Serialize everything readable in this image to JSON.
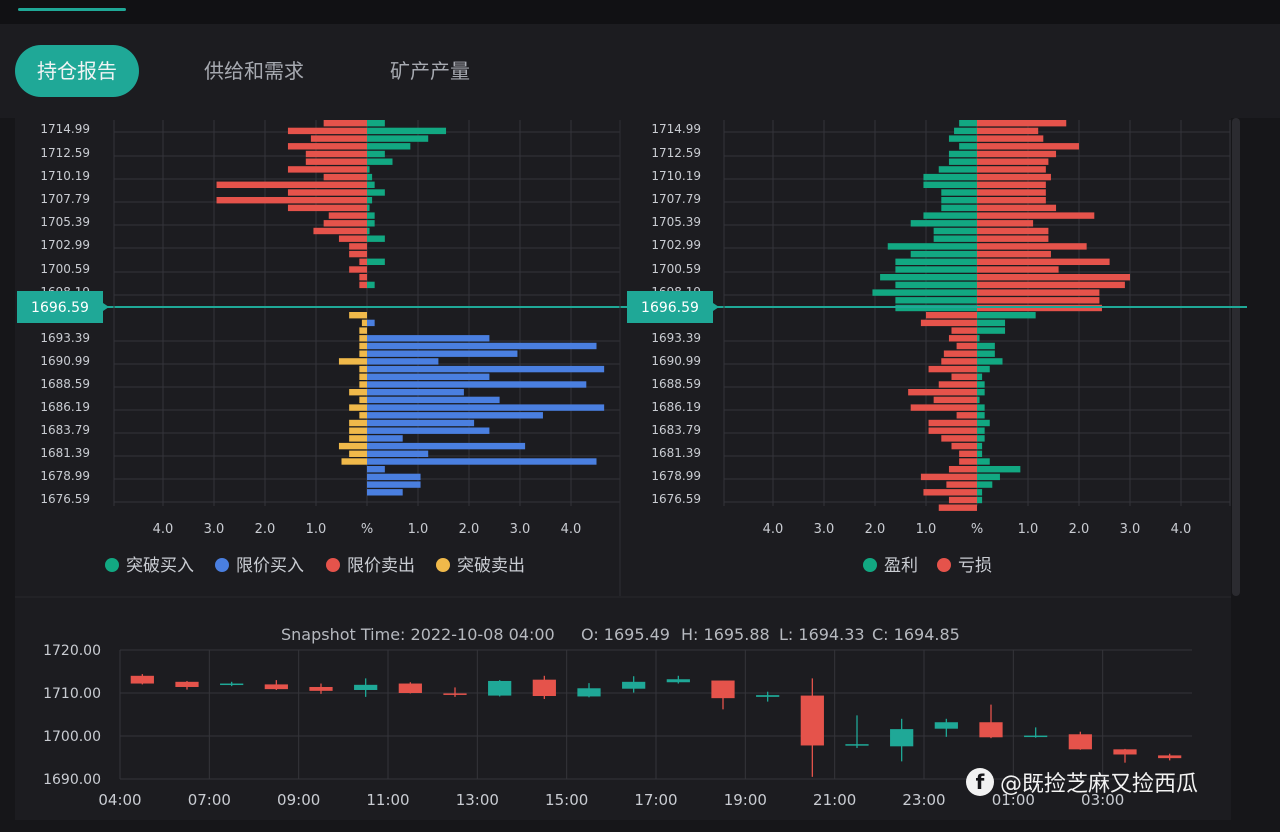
{
  "tabs": [
    {
      "label": "持仓报告",
      "active": true
    },
    {
      "label": "供给和需求",
      "active": false
    },
    {
      "label": "矿产产量",
      "active": false
    }
  ],
  "colors": {
    "green": "#12a882",
    "blue": "#4a7fe0",
    "red": "#e5534b",
    "yellow": "#f0b94a",
    "accent": "#1fa897",
    "grid": "#34343a",
    "text": "#c9ccd2"
  },
  "chart_data": [
    {
      "type": "bar",
      "orientation": "horizontal-butterfly",
      "y_tick_labels": [
        "1714.99",
        "1712.59",
        "1710.19",
        "1707.79",
        "1705.39",
        "1702.99",
        "1700.59",
        "1698.19",
        "1693.39",
        "1690.99",
        "1688.59",
        "1686.19",
        "1683.79",
        "1681.39",
        "1678.99",
        "1676.59"
      ],
      "current_price": "1696.59",
      "x_tick_labels": [
        "4.0",
        "3.0",
        "2.0",
        "1.0",
        "%",
        "1.0",
        "2.0",
        "3.0",
        "4.0"
      ],
      "xlim": [
        -4.8,
        4.8
      ],
      "legend": [
        "突破买入",
        "限价买入",
        "限价卖出",
        "突破卖出"
      ],
      "series": [
        {
          "name": "限价卖出",
          "side": "left",
          "rows_above": [
            0.85,
            1.55,
            1.1,
            1.55,
            1.2,
            1.2,
            1.55,
            0.85,
            2.95,
            1.55,
            2.95,
            1.55,
            0.75,
            0.85,
            1.05,
            0.55,
            0.35,
            0.35,
            0.15,
            0.35,
            0.15,
            0.15
          ]
        },
        {
          "name": "突破买入",
          "side": "right",
          "rows_above": [
            0.35,
            1.55,
            1.2,
            0.85,
            0.35,
            0.5,
            0.05,
            0.1,
            0.15,
            0.35,
            0.1,
            0.05,
            0.15,
            0.15,
            0.05,
            0.35,
            0.0,
            0.0,
            0.35,
            0.0,
            0.0,
            0.15
          ]
        },
        {
          "name": "突破卖出",
          "side": "left",
          "rows_below": [
            0.35,
            0.1,
            0.15,
            0.15,
            0.15,
            0.15,
            0.55,
            0.15,
            0.15,
            0.15,
            0.35,
            0.15,
            0.35,
            0.15,
            0.35,
            0.35,
            0.35,
            0.55,
            0.35,
            0.5
          ]
        },
        {
          "name": "限价买入",
          "side": "right",
          "rows_below": [
            0.0,
            0.15,
            0.0,
            2.4,
            4.5,
            2.95,
            1.4,
            4.65,
            2.4,
            4.3,
            1.9,
            2.6,
            4.65,
            3.45,
            2.1,
            2.4,
            0.7,
            3.1,
            1.2,
            4.5,
            0.35,
            1.05,
            1.05,
            0.7
          ]
        }
      ]
    },
    {
      "type": "bar",
      "orientation": "horizontal-butterfly",
      "y_tick_labels": [
        "1714.99",
        "1712.59",
        "1710.19",
        "1707.79",
        "1705.39",
        "1702.99",
        "1700.59",
        "1698.19",
        "1693.39",
        "1690.99",
        "1688.59",
        "1686.19",
        "1683.79",
        "1681.39",
        "1678.99",
        "1676.59"
      ],
      "current_price": "1696.59",
      "x_tick_labels": [
        "4.0",
        "3.0",
        "2.0",
        "1.0",
        "%",
        "1.0",
        "2.0",
        "3.0",
        "4.0"
      ],
      "xlim": [
        -4.8,
        4.8
      ],
      "legend": [
        "盈利",
        "亏损"
      ],
      "series": [
        {
          "name": "盈利",
          "rows_above": [
            0.35,
            0.45,
            0.55,
            0.35,
            0.55,
            0.55,
            0.75,
            1.05,
            1.05,
            0.7,
            0.7,
            0.7,
            1.05,
            1.3,
            0.85,
            0.85,
            1.75,
            1.3,
            1.6,
            1.6,
            1.9,
            1.6,
            2.05,
            1.6,
            1.6
          ],
          "rows_below": [
            1.15,
            0.55,
            0.55,
            0.05,
            0.35,
            0.35,
            0.5,
            0.25,
            0.1,
            0.15,
            0.15,
            0.05,
            0.15,
            0.15,
            0.25,
            0.15,
            0.15,
            0.1,
            0.1,
            0.25,
            0.85,
            0.45,
            0.3,
            0.1,
            0.1
          ]
        },
        {
          "name": "亏损",
          "rows_above": [
            1.75,
            1.2,
            1.3,
            2.0,
            1.55,
            1.4,
            1.35,
            1.45,
            1.35,
            1.35,
            1.35,
            1.55,
            2.3,
            1.1,
            1.4,
            1.4,
            2.15,
            1.45,
            2.6,
            1.6,
            3.0,
            2.9,
            2.4,
            2.4,
            2.45
          ],
          "rows_below": [
            1.0,
            1.1,
            0.5,
            0.55,
            0.4,
            0.65,
            0.7,
            0.95,
            0.5,
            0.75,
            1.35,
            0.85,
            1.3,
            0.4,
            0.95,
            0.95,
            0.7,
            0.5,
            0.35,
            0.35,
            0.55,
            1.1,
            0.6,
            1.05,
            0.55,
            0.75
          ]
        }
      ]
    },
    {
      "type": "candlestick",
      "title": "Snapshot Time: 2022-10-08 04:00",
      "ohlc_text": {
        "o": "O: 1695.49",
        "h": "H: 1695.88",
        "l": "L: 1694.33",
        "c": "C: 1694.85"
      },
      "y_tick_labels": [
        "1720.00",
        "1710.00",
        "1700.00",
        "1690.00"
      ],
      "ylim": [
        1690,
        1720
      ],
      "x_tick_labels": [
        "04:00",
        "07:00",
        "09:00",
        "11:00",
        "13:00",
        "15:00",
        "17:00",
        "19:00",
        "21:00",
        "23:00",
        "01:00",
        "03:00"
      ],
      "candles": [
        {
          "o": 1714.0,
          "c": 1712.2,
          "h": 1714.4,
          "l": 1712.0
        },
        {
          "o": 1712.6,
          "c": 1711.4,
          "h": 1712.8,
          "l": 1710.8
        },
        {
          "o": 1711.9,
          "c": 1712.2,
          "h": 1712.6,
          "l": 1711.6
        },
        {
          "o": 1712.0,
          "c": 1710.9,
          "h": 1713.0,
          "l": 1710.7
        },
        {
          "o": 1711.4,
          "c": 1710.5,
          "h": 1712.2,
          "l": 1709.8
        },
        {
          "o": 1710.7,
          "c": 1711.9,
          "h": 1713.4,
          "l": 1709.1
        },
        {
          "o": 1712.2,
          "c": 1710.0,
          "h": 1712.5,
          "l": 1709.9
        },
        {
          "o": 1709.9,
          "c": 1709.6,
          "h": 1711.3,
          "l": 1709.1
        },
        {
          "o": 1709.4,
          "c": 1712.8,
          "h": 1713.0,
          "l": 1709.2
        },
        {
          "o": 1713.1,
          "c": 1709.3,
          "h": 1714.0,
          "l": 1708.6
        },
        {
          "o": 1709.2,
          "c": 1711.1,
          "h": 1712.3,
          "l": 1709.0
        },
        {
          "o": 1711.0,
          "c": 1712.6,
          "h": 1713.9,
          "l": 1710.1
        },
        {
          "o": 1712.5,
          "c": 1713.2,
          "h": 1714.0,
          "l": 1712.2
        },
        {
          "o": 1712.9,
          "c": 1708.8,
          "h": 1712.9,
          "l": 1706.2
        },
        {
          "o": 1709.1,
          "c": 1709.5,
          "h": 1710.3,
          "l": 1708.0
        },
        {
          "o": 1709.4,
          "c": 1697.8,
          "h": 1713.4,
          "l": 1690.5
        },
        {
          "o": 1697.9,
          "c": 1698.1,
          "h": 1704.8,
          "l": 1697.2
        },
        {
          "o": 1697.6,
          "c": 1701.6,
          "h": 1704.0,
          "l": 1694.1
        },
        {
          "o": 1701.7,
          "c": 1703.2,
          "h": 1704.0,
          "l": 1699.8
        },
        {
          "o": 1703.2,
          "c": 1699.7,
          "h": 1707.3,
          "l": 1699.5
        },
        {
          "o": 1699.9,
          "c": 1700.1,
          "h": 1702.0,
          "l": 1699.6
        },
        {
          "o": 1700.4,
          "c": 1696.9,
          "h": 1701.0,
          "l": 1696.8
        },
        {
          "o": 1696.9,
          "c": 1695.7,
          "h": 1697.0,
          "l": 1693.8
        },
        {
          "o": 1695.49,
          "c": 1694.85,
          "h": 1695.88,
          "l": 1694.33
        }
      ]
    }
  ],
  "watermark": "@既捡芝麻又捡西瓜",
  "watermark_logo": "f"
}
